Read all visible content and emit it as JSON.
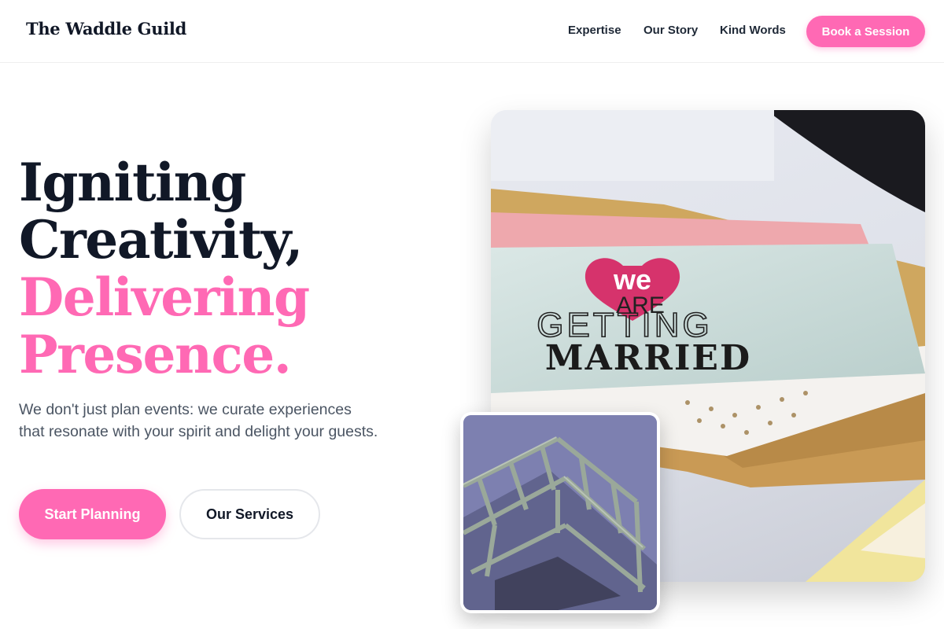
{
  "brand": {
    "name": "The Waddle Guild"
  },
  "nav": {
    "items": [
      {
        "label": "Expertise"
      },
      {
        "label": "Our Story"
      },
      {
        "label": "Kind Words"
      }
    ],
    "cta_label": "Book a Session"
  },
  "hero": {
    "headline_dark_1": "Igniting",
    "headline_dark_2": "Creativity,",
    "headline_pink_1": "Delivering",
    "headline_pink_2": "Presence.",
    "subtext": "We don't just plan events: we curate experiences that resonate with your spirit and delight your guests.",
    "primary_cta": "Start Planning",
    "secondary_cta": "Our Services"
  },
  "photo_main": {
    "card_heart_word": "we",
    "card_line_1": "ARE",
    "card_line_2": "GETTING",
    "card_line_3": "MARRIED"
  },
  "colors": {
    "accent": "#ff69b4",
    "text_dark": "#111827",
    "text_muted": "#4b5563"
  },
  "icons": {
    "photo_main": "wedding-invitation-photo",
    "photo_small": "stage-truss-photo"
  }
}
